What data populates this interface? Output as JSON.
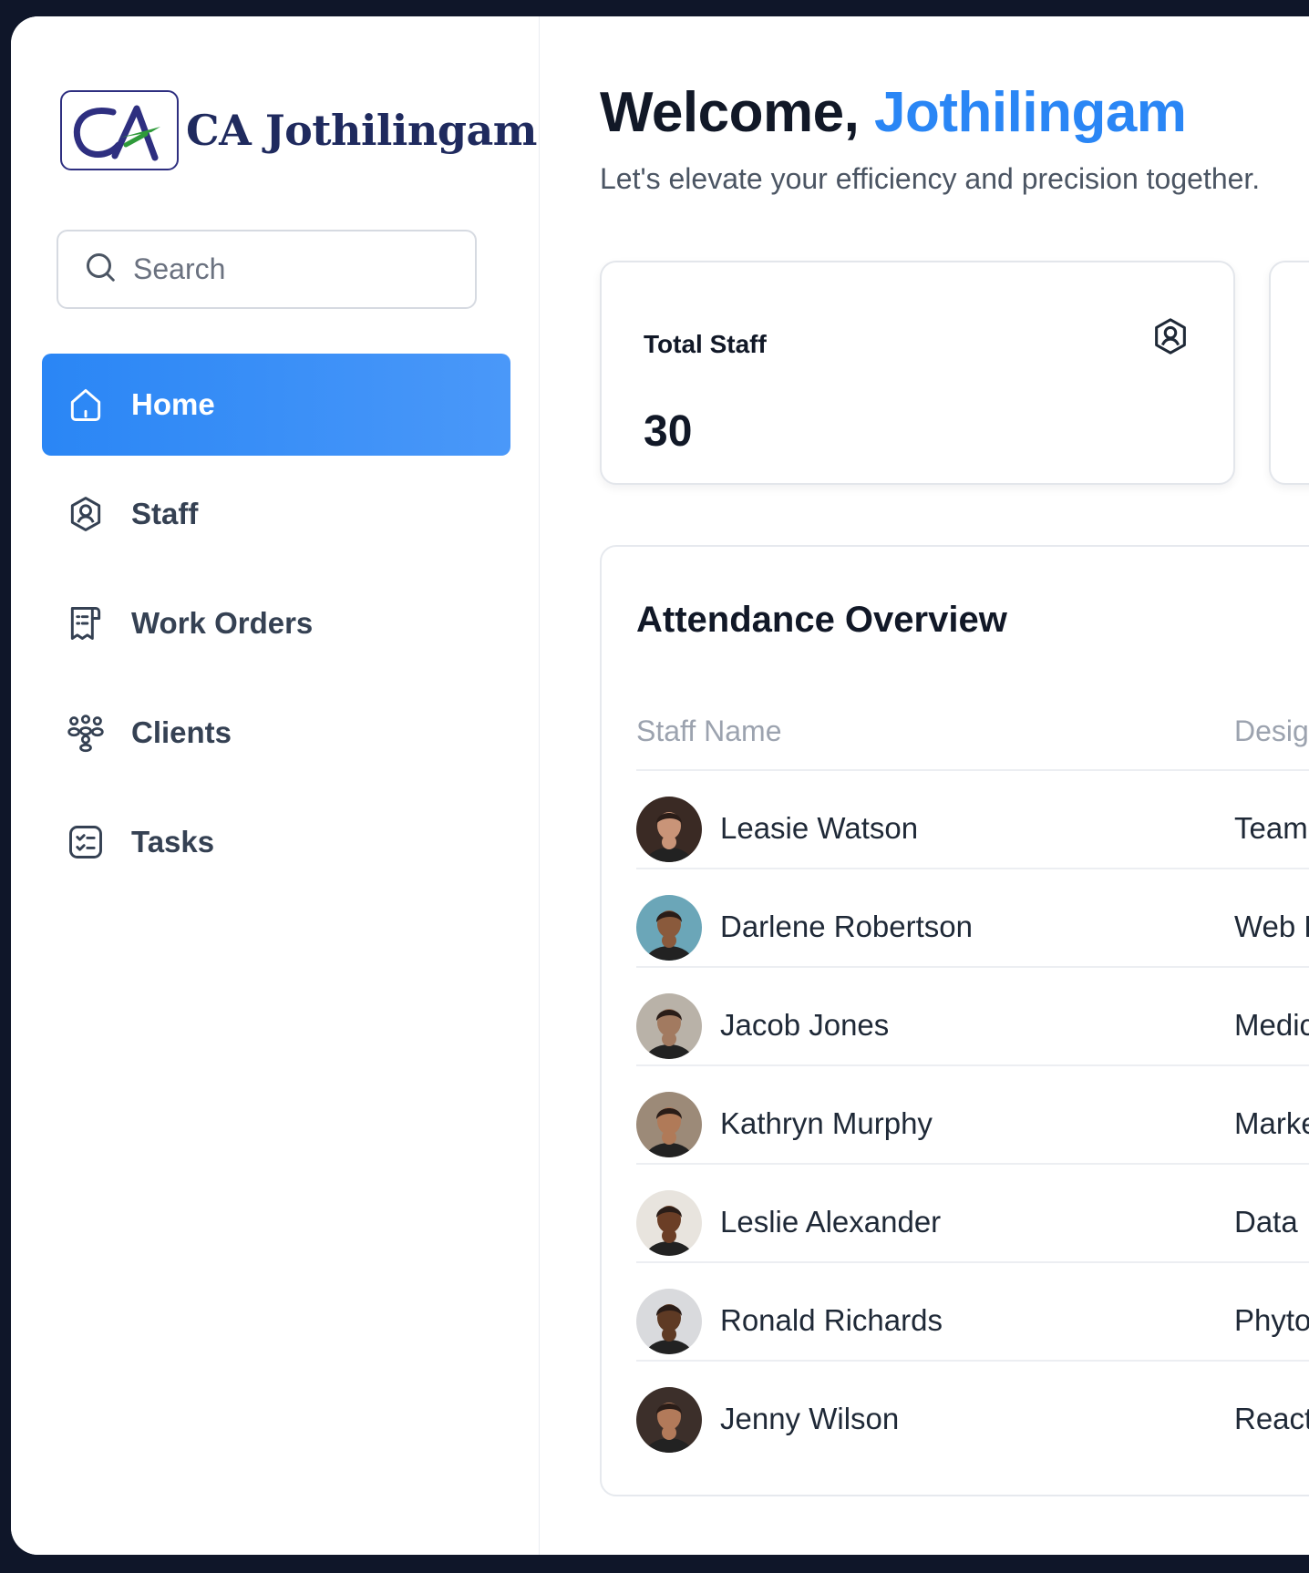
{
  "brand": {
    "name": "CA Jothilingam",
    "logo_mark": "CA"
  },
  "search": {
    "placeholder": "Search"
  },
  "nav": [
    {
      "label": "Home",
      "icon": "home-icon",
      "active": true
    },
    {
      "label": "Staff",
      "icon": "staff-badge-icon",
      "active": false
    },
    {
      "label": "Work Orders",
      "icon": "receipt-icon",
      "active": false
    },
    {
      "label": "Clients",
      "icon": "users-group-icon",
      "active": false
    },
    {
      "label": "Tasks",
      "icon": "checklist-icon",
      "active": false
    }
  ],
  "header": {
    "greeting": "Welcome, ",
    "user_name": "Jothilingam",
    "subtitle": "Let's elevate your efficiency and precision together."
  },
  "stats": {
    "total_staff_label": "Total Staff",
    "total_staff_value": "30"
  },
  "attendance": {
    "title": "Attendance Overview",
    "columns": [
      "Staff Name",
      "Desig"
    ],
    "rows": [
      {
        "name": "Leasie Watson",
        "designation": "Team",
        "avatar_bg": "#3a2a24",
        "avatar_skin": "#c99478"
      },
      {
        "name": "Darlene Robertson",
        "designation": "Web D",
        "avatar_bg": "#6ba6b8",
        "avatar_skin": "#8a5a3c"
      },
      {
        "name": "Jacob Jones",
        "designation": "Medic",
        "avatar_bg": "#b9b2a8",
        "avatar_skin": "#a27a60"
      },
      {
        "name": "Kathryn Murphy",
        "designation": "Marke",
        "avatar_bg": "#9c8a78",
        "avatar_skin": "#b07a58"
      },
      {
        "name": "Leslie Alexander",
        "designation": "Data",
        "avatar_bg": "#e8e4de",
        "avatar_skin": "#6b3e26"
      },
      {
        "name": "Ronald Richards",
        "designation": "Phyto",
        "avatar_bg": "#d9dadd",
        "avatar_skin": "#5e3a24"
      },
      {
        "name": "Jenny Wilson",
        "designation": "React",
        "avatar_bg": "#3c2f2a",
        "avatar_skin": "#b27a5a"
      }
    ]
  },
  "colors": {
    "accent": "#2a86f5",
    "frame": "#0f1629",
    "text_dark": "#111827",
    "muted": "#9ca3af"
  }
}
